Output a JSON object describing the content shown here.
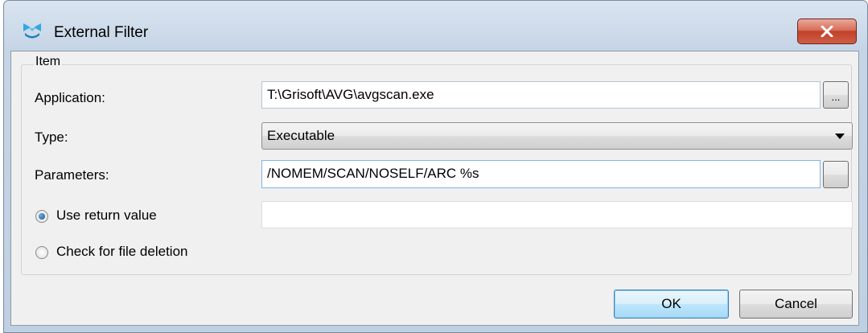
{
  "window": {
    "title": "External Filter",
    "app_icon": "external-filter-icon",
    "close_icon": "close-icon"
  },
  "group": {
    "title": "Item"
  },
  "form": {
    "application": {
      "label": "Application:",
      "value": "T:\\Grisoft\\AVG\\avgscan.exe",
      "browse_label": "..."
    },
    "type": {
      "label": "Type:",
      "selected": "Executable"
    },
    "parameters": {
      "label": "Parameters:",
      "value": "/NOMEM/SCAN/NOSELF/ARC %s",
      "browse_label": ""
    },
    "use_return_value": {
      "label": "Use return value",
      "checked": true,
      "value": ""
    },
    "check_file_deletion": {
      "label": "Check for file deletion",
      "checked": false
    }
  },
  "buttons": {
    "ok": "OK",
    "cancel": "Cancel"
  },
  "colors": {
    "title_gradient_top": "#d9e4f0",
    "close_button": "#c2412a",
    "client_background": "#f0f0f0",
    "default_button": "#bee6fd",
    "focus_border": "#7eb4ea"
  }
}
